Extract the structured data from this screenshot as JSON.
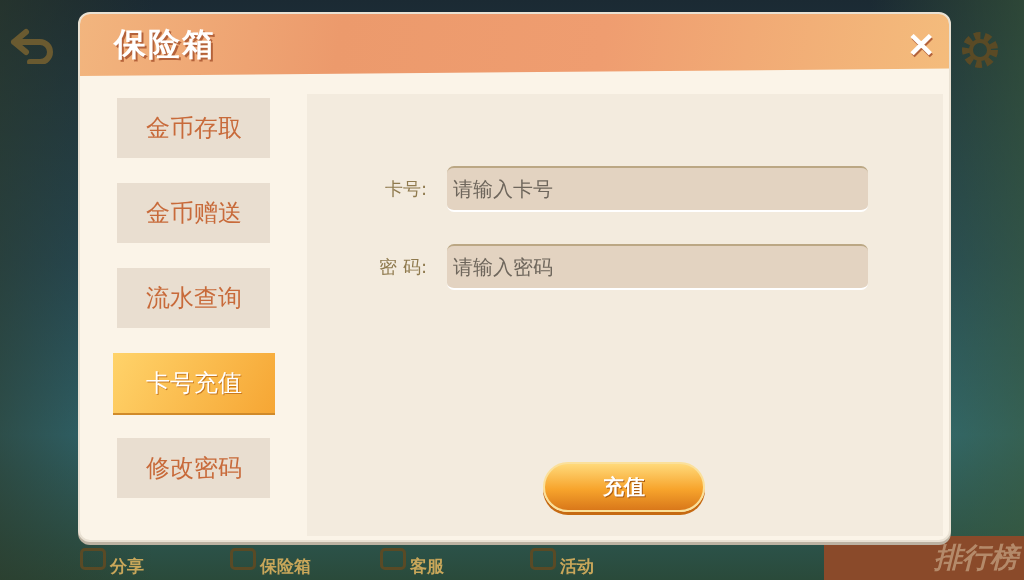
{
  "bottom_bar": [
    {
      "label": "分享"
    },
    {
      "label": "保险箱"
    },
    {
      "label": "客服"
    },
    {
      "label": "活动"
    }
  ],
  "ranking_banner": {
    "label": "排行榜"
  },
  "dialog": {
    "title": "保险箱",
    "close": "✕",
    "menu": [
      {
        "label": "金币存取",
        "selected": false
      },
      {
        "label": "金币赠送",
        "selected": false
      },
      {
        "label": "流水查询",
        "selected": false
      },
      {
        "label": "卡号充值",
        "selected": true
      },
      {
        "label": "修改密码",
        "selected": false
      }
    ],
    "fields": [
      {
        "label": "卡号:",
        "placeholder": "请输入卡号"
      },
      {
        "label": "密 码:",
        "placeholder": "请输入密码"
      }
    ],
    "submit": "充值"
  }
}
